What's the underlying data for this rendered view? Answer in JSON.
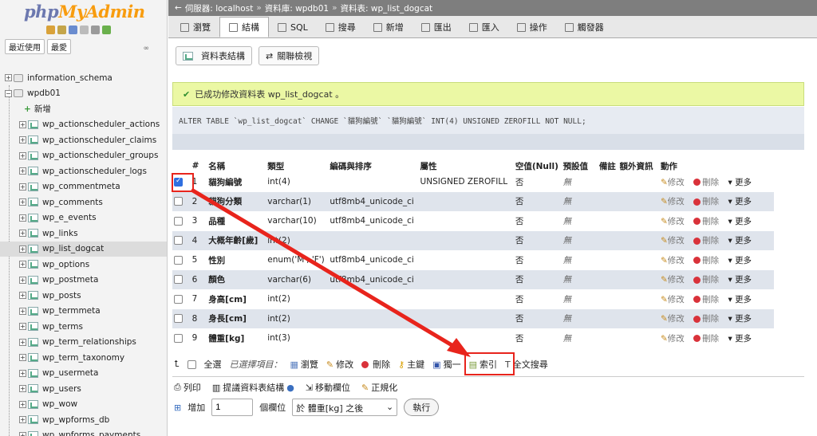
{
  "app": {
    "logo_php": "php",
    "logo_myadmin": "MyAdmin"
  },
  "sidebar": {
    "tabs": [
      "最近使用",
      "最愛"
    ],
    "link_icon": "∞",
    "items": [
      {
        "label": "information_schema",
        "type": "db",
        "expander": "+"
      },
      {
        "label": "wpdb01",
        "type": "db",
        "expander": "−"
      },
      {
        "label": "新增",
        "type": "new"
      },
      {
        "label": "wp_actionscheduler_actions",
        "type": "table"
      },
      {
        "label": "wp_actionscheduler_claims",
        "type": "table"
      },
      {
        "label": "wp_actionscheduler_groups",
        "type": "table"
      },
      {
        "label": "wp_actionscheduler_logs",
        "type": "table"
      },
      {
        "label": "wp_commentmeta",
        "type": "table"
      },
      {
        "label": "wp_comments",
        "type": "table"
      },
      {
        "label": "wp_e_events",
        "type": "table"
      },
      {
        "label": "wp_links",
        "type": "table"
      },
      {
        "label": "wp_list_dogcat",
        "type": "table",
        "selected": true
      },
      {
        "label": "wp_options",
        "type": "table"
      },
      {
        "label": "wp_postmeta",
        "type": "table"
      },
      {
        "label": "wp_posts",
        "type": "table"
      },
      {
        "label": "wp_termmeta",
        "type": "table"
      },
      {
        "label": "wp_terms",
        "type": "table"
      },
      {
        "label": "wp_term_relationships",
        "type": "table"
      },
      {
        "label": "wp_term_taxonomy",
        "type": "table"
      },
      {
        "label": "wp_usermeta",
        "type": "table"
      },
      {
        "label": "wp_users",
        "type": "table"
      },
      {
        "label": "wp_wow",
        "type": "table"
      },
      {
        "label": "wp_wpforms_db",
        "type": "table"
      },
      {
        "label": "wp_wpforms_payments",
        "type": "table"
      }
    ]
  },
  "breadcrumb": {
    "server": "伺服器: localhost",
    "db": "資料庫: wpdb01",
    "table": "資料表: wp_list_dogcat"
  },
  "tabs": [
    "瀏覽",
    "結構",
    "SQL",
    "搜尋",
    "新增",
    "匯出",
    "匯入",
    "操作",
    "觸發器"
  ],
  "active_tab": "結構",
  "subtabs": [
    "資料表結構",
    "關聯檢視"
  ],
  "success_message": "已成功修改資料表 wp_list_dogcat 。",
  "sql_query": "ALTER TABLE `wp_list_dogcat` CHANGE `貓狗編號` `貓狗編號` INT(4) UNSIGNED ZEROFILL NOT NULL;",
  "columns_header": [
    "#",
    "名稱",
    "類型",
    "編碼與排序",
    "屬性",
    "空值(Null)",
    "預設值",
    "備註",
    "額外資訊",
    "動作"
  ],
  "rows": [
    {
      "num": "1",
      "name": "貓狗編號",
      "type": "int(4)",
      "collation": "",
      "attr": "UNSIGNED ZEROFILL",
      "null": "否",
      "default": "無",
      "checked": true
    },
    {
      "num": "2",
      "name": "貓狗分類",
      "type": "varchar(1)",
      "collation": "utf8mb4_unicode_ci",
      "attr": "",
      "null": "否",
      "default": "無",
      "checked": false
    },
    {
      "num": "3",
      "name": "品種",
      "type": "varchar(10)",
      "collation": "utf8mb4_unicode_ci",
      "attr": "",
      "null": "否",
      "default": "無",
      "checked": false
    },
    {
      "num": "4",
      "name": "大概年齡[歲]",
      "type": "int(2)",
      "collation": "",
      "attr": "",
      "null": "否",
      "default": "無",
      "checked": false
    },
    {
      "num": "5",
      "name": "性別",
      "type": "enum('M', 'F')",
      "collation": "utf8mb4_unicode_ci",
      "attr": "",
      "null": "否",
      "default": "無",
      "checked": false
    },
    {
      "num": "6",
      "name": "顏色",
      "type": "varchar(6)",
      "collation": "utf8mb4_unicode_ci",
      "attr": "",
      "null": "否",
      "default": "無",
      "checked": false
    },
    {
      "num": "7",
      "name": "身高[cm]",
      "type": "int(2)",
      "collation": "",
      "attr": "",
      "null": "否",
      "default": "無",
      "checked": false
    },
    {
      "num": "8",
      "name": "身長[cm]",
      "type": "int(2)",
      "collation": "",
      "attr": "",
      "null": "否",
      "default": "無",
      "checked": false
    },
    {
      "num": "9",
      "name": "體重[kg]",
      "type": "int(3)",
      "collation": "",
      "attr": "",
      "null": "否",
      "default": "無",
      "checked": false
    }
  ],
  "row_actions": {
    "edit": "修改",
    "delete": "刪除",
    "more": "更多"
  },
  "bulk": {
    "check_all": "全選",
    "selected_label": "已選擇項目：",
    "browse": "瀏覽",
    "edit": "修改",
    "delete": "刪除",
    "primary": "主鍵",
    "unique": "獨一",
    "index": "索引",
    "fulltext": "全文搜尋"
  },
  "bottom": {
    "print": "列印",
    "propose": "提議資料表結構",
    "move_columns": "移動欄位",
    "normalize": "正規化",
    "add_label": "增加",
    "add_count": "1",
    "columns_label": "個欄位",
    "position": "於 體重[kg] 之後",
    "go": "執行"
  },
  "colors": {
    "highlight": "#e8241c",
    "success_bg": "#ebf8a4",
    "row_alt": "#dfe4ec"
  }
}
